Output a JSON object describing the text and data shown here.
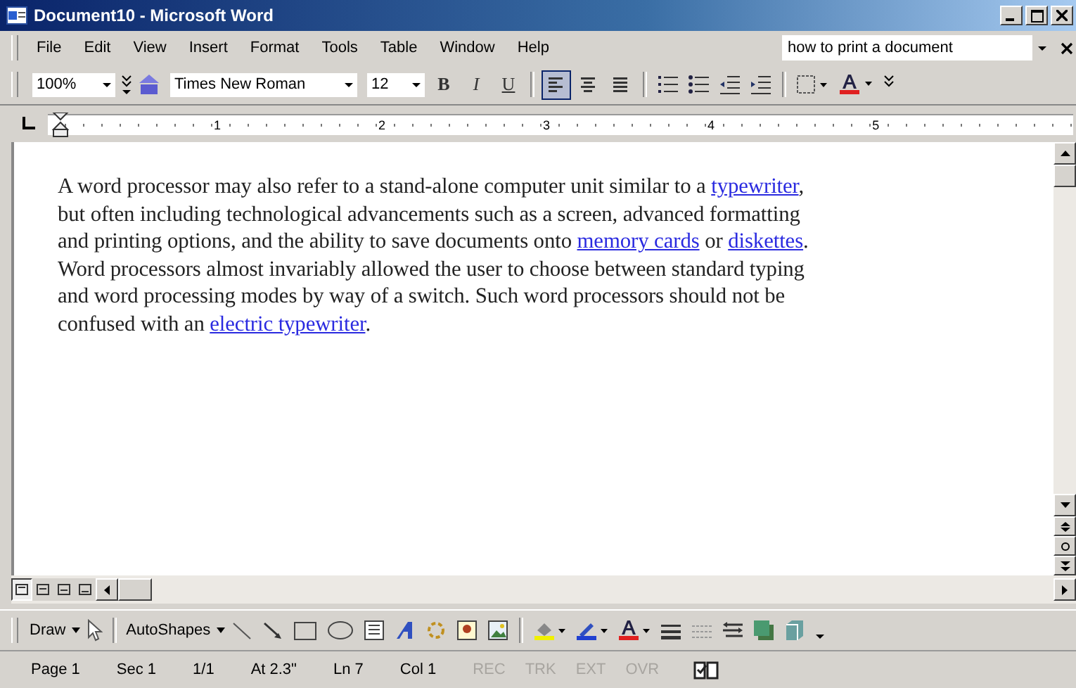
{
  "window": {
    "title": "Document10 - Microsoft Word"
  },
  "menu": [
    {
      "label": "File"
    },
    {
      "label": "Edit"
    },
    {
      "label": "View"
    },
    {
      "label": "Insert"
    },
    {
      "label": "Format"
    },
    {
      "label": "Tools"
    },
    {
      "label": "Table"
    },
    {
      "label": "Window"
    },
    {
      "label": "Help"
    }
  ],
  "help_box": {
    "value": "how to print a document"
  },
  "formatting": {
    "zoom": "100%",
    "font": "Times New Roman",
    "size": "12",
    "bold": "B",
    "italic": "I",
    "underline": "U",
    "alignment": [
      {
        "kind": "left",
        "selected": true
      },
      {
        "kind": "center",
        "selected": false
      },
      {
        "kind": "justify",
        "selected": false
      }
    ]
  },
  "ruler": {
    "numbers": [
      "1",
      "2",
      "3",
      "4",
      "5"
    ]
  },
  "document": {
    "lines": [
      [
        {
          "kind": "text",
          "text": "A word processor may also refer to a stand-alone computer unit similar to a "
        },
        {
          "kind": "link",
          "text": "typewriter"
        },
        {
          "kind": "text",
          "text": ","
        }
      ],
      [
        {
          "kind": "text",
          "text": "but often including technological advancements such as a screen, advanced formatting"
        }
      ],
      [
        {
          "kind": "text",
          "text": "and printing options, and the ability to save documents onto "
        },
        {
          "kind": "link",
          "text": "memory cards"
        },
        {
          "kind": "text",
          "text": " or "
        },
        {
          "kind": "link",
          "text": "diskettes"
        },
        {
          "kind": "text",
          "text": "."
        }
      ],
      [
        {
          "kind": "text",
          "text": "Word processors almost invariably allowed the user to choose between standard typing"
        }
      ],
      [
        {
          "kind": "text",
          "text": "and word processing modes by way of a switch. Such word processors should not be"
        }
      ],
      [
        {
          "kind": "text",
          "text": "confused with an "
        },
        {
          "kind": "link",
          "text": "electric typewriter"
        },
        {
          "kind": "text",
          "text": "."
        }
      ]
    ]
  },
  "views": [
    {
      "selected": true
    },
    {
      "selected": false
    },
    {
      "selected": false
    },
    {
      "selected": false
    }
  ],
  "drawing": {
    "draw": "Draw",
    "autoshapes": "AutoShapes"
  },
  "status_bar": {
    "fields": [
      "Page 1",
      "Sec 1",
      "1/1",
      "At 2.3\"",
      "Ln 7",
      "Col 1"
    ],
    "modes": [
      {
        "label": "REC",
        "on": false
      },
      {
        "label": "TRK",
        "on": false
      },
      {
        "label": "EXT",
        "on": false
      },
      {
        "label": "OVR",
        "on": false
      }
    ]
  }
}
